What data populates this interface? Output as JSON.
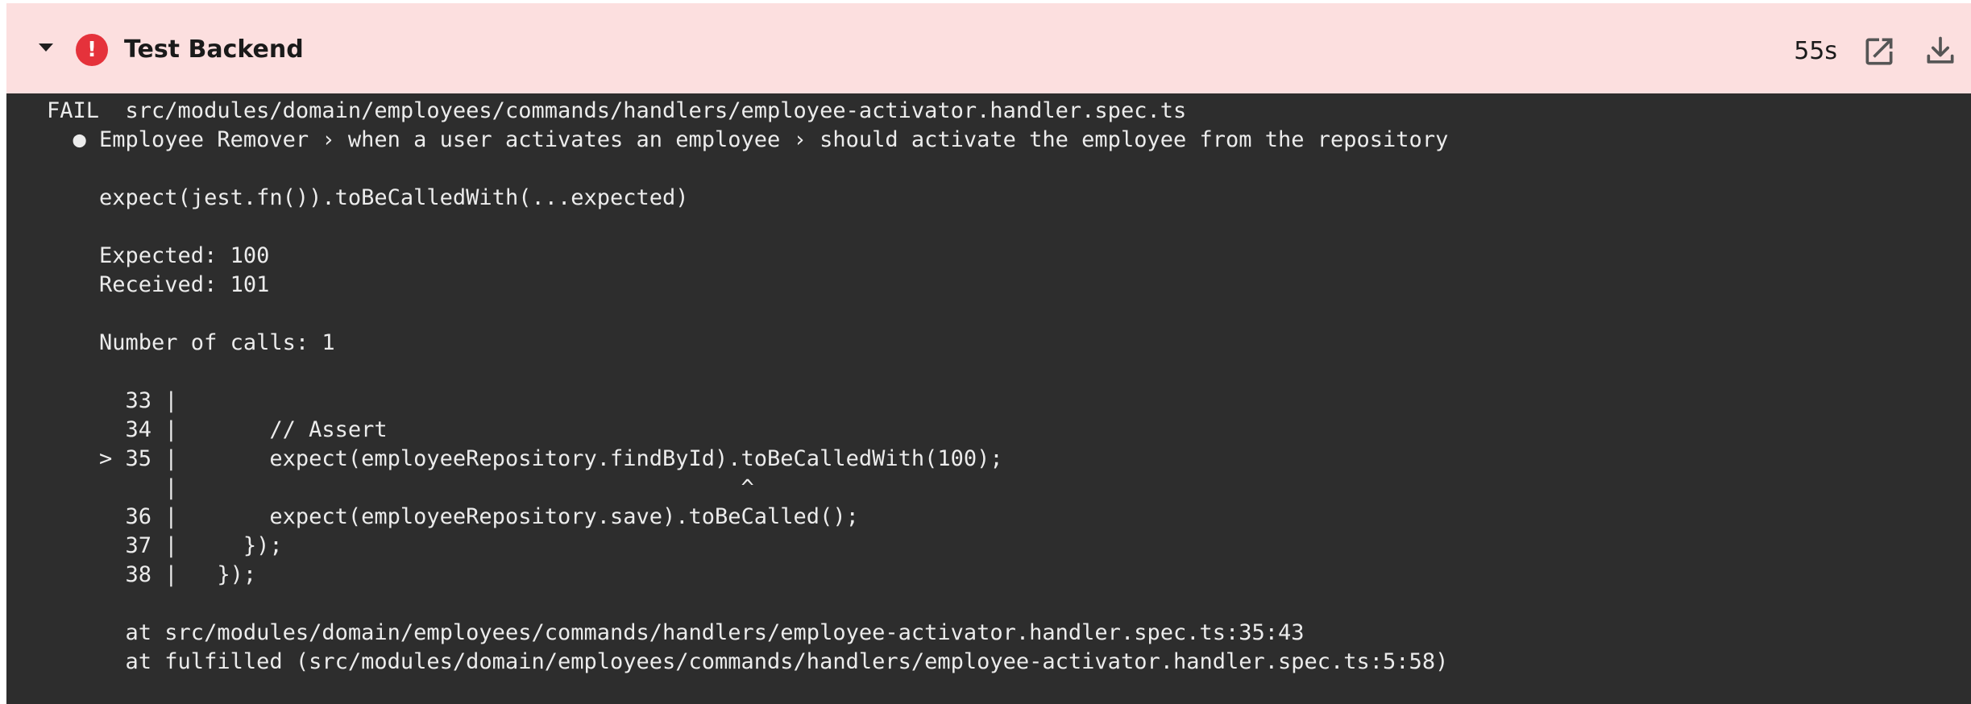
{
  "header": {
    "title": "Test Backend",
    "status_icon_glyph": "!",
    "duration": "55s",
    "background_color": "#fcdfdf",
    "status_color": "#e5323b",
    "icons": {
      "collapse": "chevron-down-icon",
      "status": "error-icon",
      "open": "open-in-new-icon",
      "download": "download-icon"
    }
  },
  "log": {
    "background_color": "#2d2d2d",
    "lines": [
      "FAIL  src/modules/domain/employees/commands/handlers/employee-activator.handler.spec.ts",
      "  ● Employee Remover › when a user activates an employee › should activate the employee from the repository",
      "",
      "    expect(jest.fn()).toBeCalledWith(...expected)",
      "",
      "    Expected: 100",
      "    Received: 101",
      "",
      "    Number of calls: 1",
      "",
      "      33 |",
      "      34 |       // Assert",
      "    > 35 |       expect(employeeRepository.findById).toBeCalledWith(100);",
      "         |                                           ^",
      "      36 |       expect(employeeRepository.save).toBeCalled();",
      "      37 |     });",
      "      38 |   });",
      "",
      "      at src/modules/domain/employees/commands/handlers/employee-activator.handler.spec.ts:35:43",
      "      at fulfilled (src/modules/domain/employees/commands/handlers/employee-activator.handler.spec.ts:5:58)"
    ]
  }
}
